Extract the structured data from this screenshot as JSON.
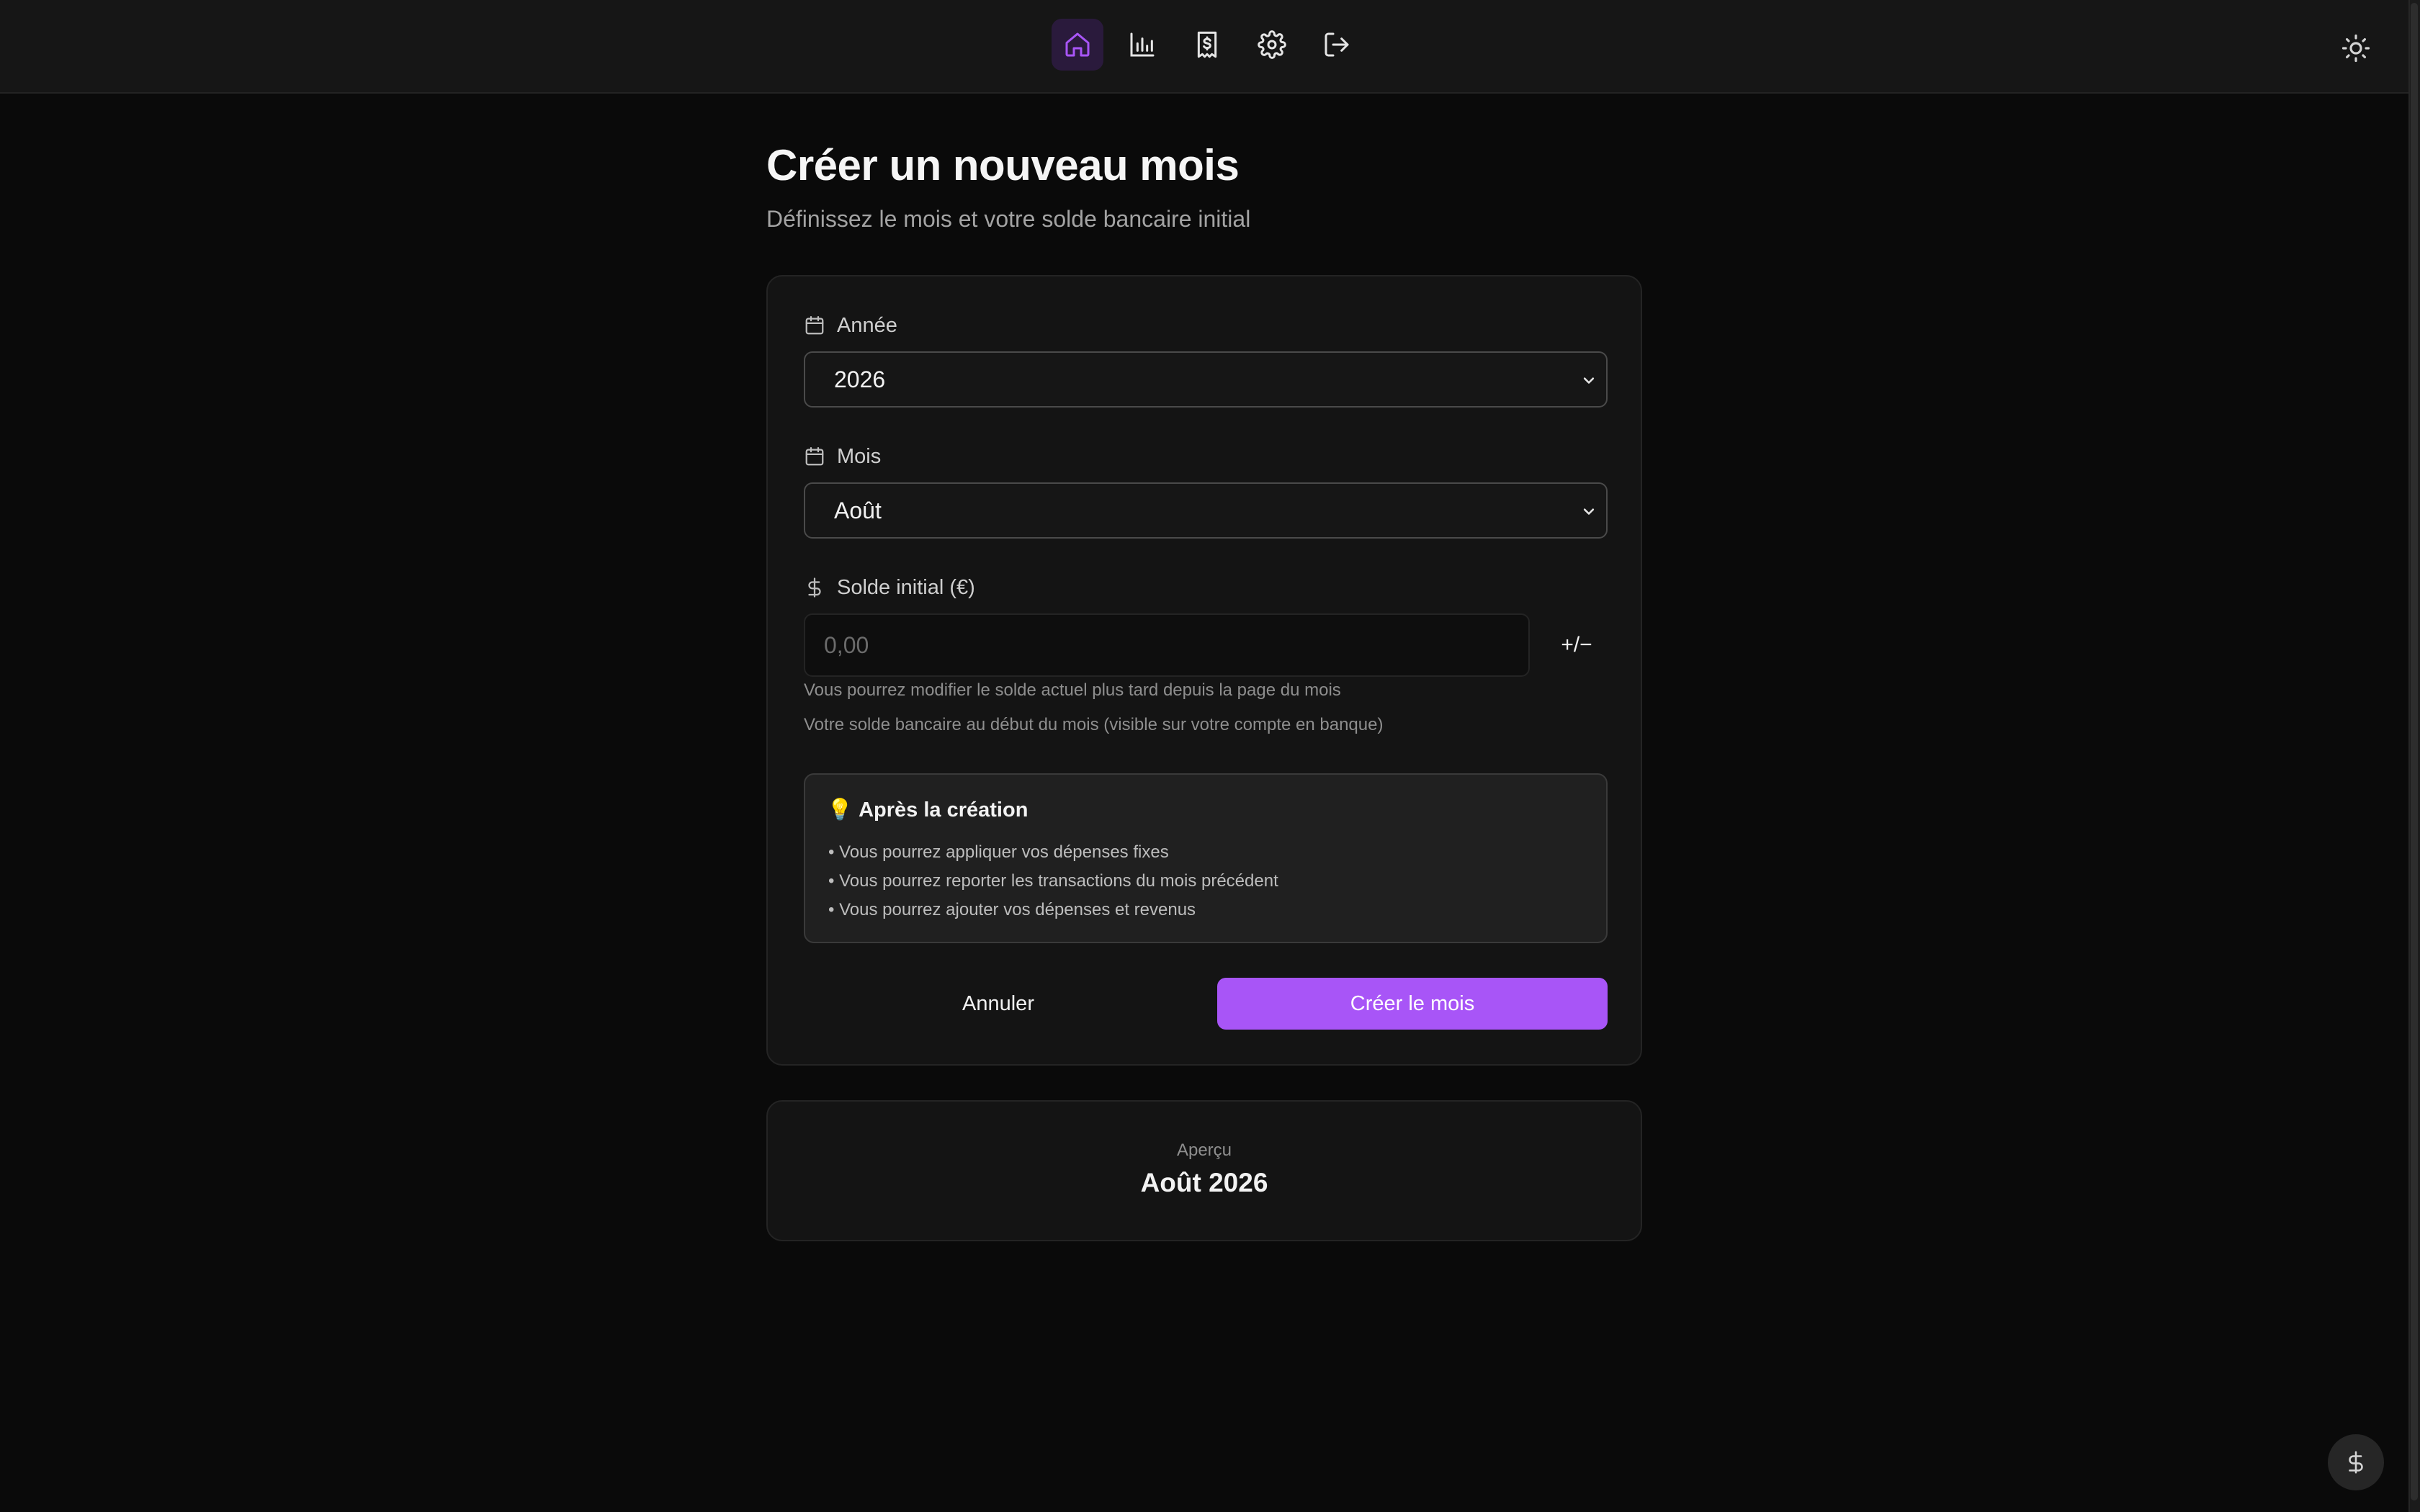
{
  "nav": {
    "items": [
      {
        "icon": "home-icon",
        "active": true
      },
      {
        "icon": "bar-chart-icon",
        "active": false
      },
      {
        "icon": "receipt-dollar-icon",
        "active": false
      },
      {
        "icon": "gear-icon",
        "active": false
      },
      {
        "icon": "logout-icon",
        "active": false
      }
    ],
    "theme_icon": "sun-icon"
  },
  "page": {
    "title": "Créer un nouveau mois",
    "subtitle": "Définissez le mois et votre solde bancaire initial"
  },
  "form": {
    "year_label": "Année",
    "year_value": "2026",
    "month_label": "Mois",
    "month_value": "Août",
    "balance_label": "Solde initial (€)",
    "balance_placeholder": "0,00",
    "sign_toggle": "+/−",
    "help_1": "Vous pourrez modifier le solde actuel plus tard depuis la page du mois",
    "help_2": "Votre solde bancaire au début du mois (visible sur votre compte en banque)"
  },
  "tips": {
    "icon": "💡",
    "title": "Après la création",
    "items": [
      "Vous pourrez appliquer vos dépenses fixes",
      "Vous pourrez reporter les transactions du mois précédent",
      "Vous pourrez ajouter vos dépenses et revenus"
    ]
  },
  "actions": {
    "cancel_label": "Annuler",
    "create_label": "Créer le mois"
  },
  "preview": {
    "label": "Aperçu",
    "value": "Août 2026"
  },
  "colors": {
    "accent": "#a855f7",
    "background": "#0a0a0a",
    "card": "#141414"
  }
}
